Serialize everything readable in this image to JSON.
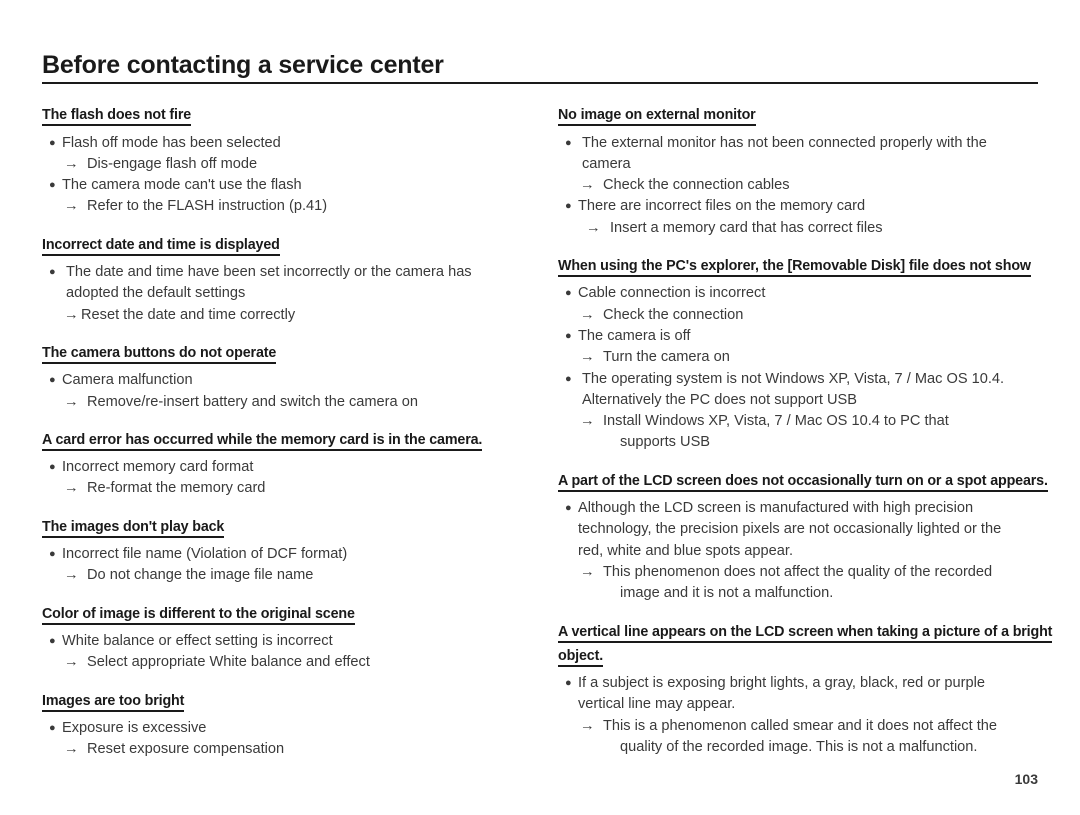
{
  "document": {
    "title": "Before contacting a service center",
    "page_number": "103"
  },
  "left_column": [
    {
      "heading": "The flash does not fire",
      "lines": [
        {
          "type": "bullet",
          "text": "Flash off mode has been selected"
        },
        {
          "type": "arrow",
          "text": "Dis-engage flash off mode"
        },
        {
          "type": "bullet",
          "text": "The camera mode can't use the flash"
        },
        {
          "type": "arrow",
          "text": "Refer to the FLASH instruction (p.41)"
        }
      ]
    },
    {
      "heading": "Incorrect date and time is displayed",
      "lines": [
        {
          "type": "bullet-spaced",
          "text": "The date and time have been set incorrectly or the camera has"
        },
        {
          "type": "continuation",
          "text": "adopted the default settings"
        },
        {
          "type": "arrow-tight",
          "text": "Reset the date and time correctly"
        }
      ]
    },
    {
      "heading": "The camera buttons do not operate",
      "lines": [
        {
          "type": "bullet",
          "text": "Camera malfunction"
        },
        {
          "type": "arrow",
          "text": "Remove/re-insert battery and switch the camera on"
        }
      ]
    },
    {
      "heading": "A card error has occurred while the memory card is in the camera.",
      "lines": [
        {
          "type": "bullet",
          "text": "Incorrect memory card format"
        },
        {
          "type": "arrow",
          "text": "Re-format the memory card"
        }
      ]
    },
    {
      "heading": "The images don't play back",
      "lines": [
        {
          "type": "bullet",
          "text": "Incorrect file name (Violation of DCF format)"
        },
        {
          "type": "arrow",
          "text": "Do not change the image file name"
        }
      ]
    },
    {
      "heading": "Color of image is different to the original scene",
      "lines": [
        {
          "type": "bullet",
          "text": "White balance or effect setting is incorrect"
        },
        {
          "type": "arrow",
          "text": "Select appropriate White balance and effect"
        }
      ]
    },
    {
      "heading": "Images are too bright",
      "lines": [
        {
          "type": "bullet",
          "text": "Exposure is excessive"
        },
        {
          "type": "arrow",
          "text": "Reset exposure compensation"
        }
      ]
    }
  ],
  "right_column": [
    {
      "heading": "No image on external monitor",
      "lines": [
        {
          "type": "bullet-spaced",
          "text": "The external monitor has not been connected properly with the"
        },
        {
          "type": "continuation",
          "text": "camera"
        },
        {
          "type": "arrow",
          "text": "Check the connection cables"
        },
        {
          "type": "bullet",
          "text": "There are incorrect files on the memory card"
        },
        {
          "type": "arrow-deep",
          "text": "Insert a memory card that has correct files"
        }
      ]
    },
    {
      "heading": "When using the PC's explorer, the [Removable Disk] file does not show",
      "lines": [
        {
          "type": "bullet",
          "text": "Cable connection is incorrect"
        },
        {
          "type": "arrow",
          "text": "Check the connection"
        },
        {
          "type": "bullet",
          "text": "The camera is off"
        },
        {
          "type": "arrow",
          "text": "Turn the camera on"
        },
        {
          "type": "bullet-spaced",
          "text": "The operating system is not Windows XP, Vista, 7 / Mac OS 10.4."
        },
        {
          "type": "continuation",
          "text": "Alternatively the PC does not support USB"
        },
        {
          "type": "arrow",
          "text": "Install Windows XP, Vista, 7 / Mac OS 10.4 to PC that"
        },
        {
          "type": "arrow-continuation",
          "text": "supports USB"
        }
      ]
    },
    {
      "heading": "A part of the LCD screen does not occasionally turn on or a spot appears.",
      "lines": [
        {
          "type": "bullet",
          "text": "Although the LCD screen is manufactured with high precision"
        },
        {
          "type": "continuation-narrow",
          "text": "technology, the precision pixels are not occasionally lighted or the"
        },
        {
          "type": "continuation-narrow",
          "text": "red, white and blue spots appear."
        },
        {
          "type": "arrow",
          "text": "This phenomenon does not affect the quality of the recorded"
        },
        {
          "type": "arrow-continuation",
          "text": "image and it is not a malfunction."
        }
      ]
    },
    {
      "heading": "A vertical line appears on the LCD screen when taking a picture of a bright object.",
      "lines": [
        {
          "type": "bullet",
          "text": "If a subject is exposing bright lights, a gray, black, red or purple"
        },
        {
          "type": "continuation-narrow",
          "text": "vertical line may appear."
        },
        {
          "type": "arrow",
          "text": "This is a phenomenon called smear and it does not affect the"
        },
        {
          "type": "arrow-continuation",
          "text": "quality of the recorded image. This is not a malfunction."
        }
      ]
    }
  ],
  "glyphs": {
    "bullet": "●",
    "arrow": "→"
  }
}
